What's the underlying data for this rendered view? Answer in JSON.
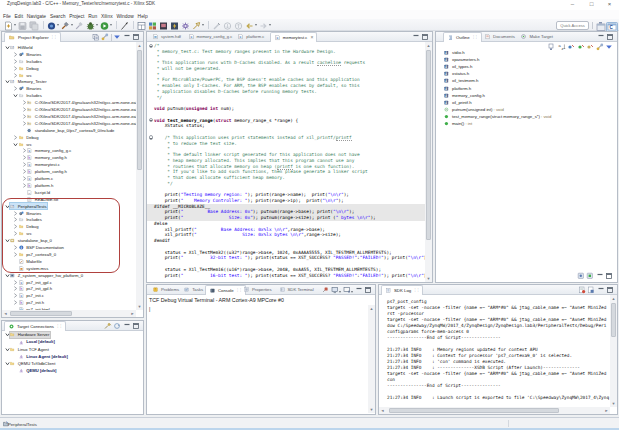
{
  "window": {
    "title": "ZynqDesign.lab3 - C/C++ - Memory_Tester/src/memorytest.c - Xilinx SDK",
    "controls": {
      "minimize": "–",
      "maximize": "□",
      "close": "×"
    }
  },
  "menu": {
    "items": [
      "File",
      "Edit",
      "Navigate",
      "Search",
      "Project",
      "Run",
      "Xilinx",
      "Window",
      "Help"
    ]
  },
  "toolbar": {
    "quick_access_label": "Quick Access",
    "icons": [
      "new-wizard",
      "save",
      "save-all",
      "sep",
      "debug-config",
      "build",
      "build-all",
      "debug",
      "run",
      "sep",
      "new-cpp",
      "sep",
      "window-grid",
      "program-fpga",
      "dump-data",
      "program-flash",
      "sdk-gear",
      "launch-shell",
      "sep",
      "mark-occurrences",
      "next-annotation",
      "prev-annotation",
      "back",
      "forward"
    ],
    "perspective_icons": [
      "open-perspective",
      "cpp-perspective"
    ]
  },
  "project_explorer": {
    "tab": "Project Explorer",
    "header_icons": [
      "collapse-all",
      "link-editor",
      "hsep",
      "view-menu",
      "minimize",
      "maximize"
    ],
    "tree": [
      {
        "lv": 0,
        "ar": "v",
        "ic": "cproj",
        "lb": "HiWorld"
      },
      {
        "lv": 1,
        "ar": ">",
        "ic": "bin",
        "lb": "Binaries"
      },
      {
        "lv": 1,
        "ar": ">",
        "ic": "incs",
        "lb": "Includes"
      },
      {
        "lv": 1,
        "ar": ">",
        "ic": "fold",
        "lb": "Debug"
      },
      {
        "lv": 1,
        "ar": ">",
        "ic": "fold",
        "lb": "src"
      },
      {
        "lv": 0,
        "ar": "v",
        "ic": "cproj",
        "lb": "Memory_Tester"
      },
      {
        "lv": 1,
        "ar": ">",
        "ic": "bin",
        "lb": "Binaries"
      },
      {
        "lv": 1,
        "ar": "v",
        "ic": "incs",
        "lb": "Includes"
      },
      {
        "lv": 2,
        "ar": ">",
        "ic": "incpath",
        "lb": "C:/Xilinx/SDK/2017.4/gnu/aarch32/nt/gcc-arm-none-eabi/arm-none-eabi/include"
      },
      {
        "lv": 2,
        "ar": ">",
        "ic": "incpath",
        "lb": "C:/Xilinx/SDK/2017.4/gnu/aarch32/nt/gcc-arm-none-eabi/arm-none-eabi/include"
      },
      {
        "lv": 2,
        "ar": ">",
        "ic": "incpath",
        "lb": "C:/Xilinx/SDK/2017.4/gnu/aarch32/nt/gcc-arm-none-eabi/arm-none-eabi/include"
      },
      {
        "lv": 2,
        "ar": ">",
        "ic": "incpath",
        "lb": "C:/Xilinx/SDK/2017.4/gnu/aarch32/nt/gcc-arm-none-eabi/arm-none-eabi/include"
      },
      {
        "lv": 2,
        "ar": "",
        "ic": "gearinc",
        "lb": "standalone_bsp_0/ps7_cortexa9_0/include"
      },
      {
        "lv": 1,
        "ar": ">",
        "ic": "fold",
        "lb": "Debug"
      },
      {
        "lv": 1,
        "ar": "v",
        "ic": "fold",
        "lb": "src"
      },
      {
        "lv": 2,
        "ar": ">",
        "ic": "cfile",
        "lb": "memory_config_g.c"
      },
      {
        "lv": 2,
        "ar": ">",
        "ic": "hfile",
        "lb": "memory_config.h"
      },
      {
        "lv": 2,
        "ar": ">",
        "ic": "cfile",
        "lb": "memorytest.c"
      },
      {
        "lv": 2,
        "ar": ">",
        "ic": "hfile",
        "lb": "platform_config.h"
      },
      {
        "lv": 2,
        "ar": ">",
        "ic": "cfile",
        "lb": "platform.c"
      },
      {
        "lv": 2,
        "ar": ">",
        "ic": "hfile",
        "lb": "platform.h"
      },
      {
        "lv": 2,
        "ar": "",
        "ic": "ldfile",
        "lb": "lscript.ld"
      },
      {
        "lv": 2,
        "ar": "",
        "ic": "txtfile",
        "lb": "README.txt"
      },
      {
        "lv": 0,
        "ar": "v",
        "ic": "cproj",
        "lb": "PeripheralTests",
        "sel": 1
      },
      {
        "lv": 1,
        "ar": ">",
        "ic": "bin",
        "lb": "Binaries"
      },
      {
        "lv": 1,
        "ar": ">",
        "ic": "incs",
        "lb": "Includes"
      },
      {
        "lv": 1,
        "ar": ">",
        "ic": "fold",
        "lb": "Debug"
      },
      {
        "lv": 1,
        "ar": ">",
        "ic": "fold",
        "lb": "src"
      },
      {
        "lv": 0,
        "ar": "v",
        "ic": "bsp",
        "lb": "standalone_bsp_0"
      },
      {
        "lv": 1,
        "ar": ">",
        "ic": "info",
        "lb": "BSP Documentation"
      },
      {
        "lv": 1,
        "ar": ">",
        "ic": "fold",
        "lb": "ps7_cortexa9_0"
      },
      {
        "lv": 1,
        "ar": "",
        "ic": "makefile",
        "lb": "Makefile"
      },
      {
        "lv": 1,
        "ar": "",
        "ic": "mss",
        "lb": "system.mss"
      },
      {
        "lv": 0,
        "ar": "v",
        "ic": "hw",
        "lb": "Z_system_wrapper_hw_platform_0"
      },
      {
        "lv": 1,
        "ar": ">",
        "ic": "cfile",
        "lb": "ps7_init_gpl.c"
      },
      {
        "lv": 1,
        "ar": ">",
        "ic": "hfile",
        "lb": "ps7_init_gpl.h"
      },
      {
        "lv": 1,
        "ar": ">",
        "ic": "cfile",
        "lb": "ps7_init.c"
      },
      {
        "lv": 1,
        "ar": ">",
        "ic": "hfile",
        "lb": "ps7_init.h"
      },
      {
        "lv": 1,
        "ar": "",
        "ic": "html",
        "lb": "ps7_init.html"
      }
    ]
  },
  "target_connections": {
    "tab": "Target Connections",
    "header_icons": [
      "new-connection",
      "refresh-connection",
      "minimize",
      "maximize"
    ],
    "tree": [
      {
        "lv": 0,
        "ar": "v",
        "ic": "fold",
        "lb": "Hardware Server",
        "sel": 1
      },
      {
        "lv": 1,
        "ar": "",
        "ic": "target",
        "lb": "Local [default]",
        "bold": 1
      },
      {
        "lv": 0,
        "ar": "v",
        "ic": "fold",
        "lb": "Linux TCF Agent"
      },
      {
        "lv": 1,
        "ar": "",
        "ic": "target",
        "lb": "Linux Agent [default]",
        "bold": 1
      },
      {
        "lv": 0,
        "ar": "v",
        "ic": "fold",
        "lb": "QEMU TcfGdbClient"
      },
      {
        "lv": 1,
        "ar": "",
        "ic": "target",
        "lb": "QEMU [default]",
        "bold": 1
      }
    ]
  },
  "editor": {
    "tabs": [
      {
        "label": "system.hdf",
        "icon": "hdf"
      },
      {
        "label": "memory_config_g.c",
        "icon": "cfile"
      },
      {
        "label": "platform.c",
        "icon": "cfile"
      },
      {
        "label": "memorytest.c",
        "icon": "cfile",
        "active": 1,
        "close": "×"
      }
    ],
    "header_icons": [
      "minimize",
      "maximize"
    ],
    "code": [
      {
        "sp": [
          [
            "c",
            "/*"
          ]
        ]
      },
      {
        "sp": [
          [
            "c",
            " * memory_test.c: Test memory ranges present in the Hardware Design."
          ]
        ]
      },
      {
        "sp": [
          [
            "c",
            " *"
          ]
        ]
      },
      {
        "sp": [
          [
            "c",
            " * This application runs with D-Caches disabled. As a result "
          ],
          [
            "u",
            "cacheline"
          ],
          [
            "c",
            " requests"
          ]
        ]
      },
      {
        "sp": [
          [
            "c",
            " * will not be generated."
          ]
        ]
      },
      {
        "sp": [
          [
            "c",
            " *"
          ]
        ]
      },
      {
        "sp": [
          [
            "c",
            " * For MicroBlaze/PowerPC, the BSP doesn't enable caches and this application"
          ]
        ]
      },
      {
        "sp": [
          [
            "c",
            " * enables only I-Caches. For ARM, the BSP enables caches by default, so this"
          ]
        ]
      },
      {
        "sp": [
          [
            "c",
            " * application disables D-Caches before running memory tests."
          ]
        ]
      },
      {
        "sp": [
          [
            "c",
            " */"
          ]
        ]
      },
      {
        "sp": []
      },
      {
        "sp": [
          [
            "k",
            "void"
          ],
          [
            "p",
            " putnum("
          ],
          [
            "k",
            "unsigned"
          ],
          [
            "p",
            " "
          ],
          [
            "k",
            "int"
          ],
          [
            "p",
            " num);"
          ]
        ]
      },
      {
        "sp": []
      },
      {
        "sp": [
          [
            "k",
            "void"
          ],
          [
            "p",
            " "
          ],
          [
            "f",
            "test_memory_range"
          ],
          [
            "p",
            "("
          ],
          [
            "k",
            "struct"
          ],
          [
            "p",
            " memory_range_s *range) {"
          ]
        ]
      },
      {
        "sp": [
          [
            "p",
            "    XStatus status;"
          ]
        ]
      },
      {
        "sp": []
      },
      {
        "sp": [
          [
            "c",
            "    /* This application uses print statements instead of xil_printf/"
          ],
          [
            "u",
            "printf"
          ]
        ]
      },
      {
        "sp": [
          [
            "c",
            "     * to reduce the text size."
          ]
        ]
      },
      {
        "sp": [
          [
            "c",
            "     *"
          ]
        ]
      },
      {
        "sp": [
          [
            "c",
            "     * The default linker script generated for this application does not have"
          ]
        ]
      },
      {
        "sp": [
          [
            "c",
            "     * heap memory allocated. This implies that this program cannot use any"
          ]
        ]
      },
      {
        "sp": [
          [
            "c",
            "     * routines that allocate memory on heap ("
          ],
          [
            "u",
            "printf"
          ],
          [
            "c",
            " is one such function)."
          ]
        ]
      },
      {
        "sp": [
          [
            "c",
            "     * If you'd like to add such functions, then please generate a linker script"
          ]
        ]
      },
      {
        "sp": [
          [
            "c",
            "     * that does allocate sufficient heap memory."
          ]
        ]
      },
      {
        "sp": [
          [
            "c",
            "     */"
          ]
        ]
      },
      {
        "sp": []
      },
      {
        "sp": [
          [
            "p",
            "    print("
          ],
          [
            "s",
            "\"Testing memory region: \""
          ],
          [
            "p",
            "); print(range->name);  print("
          ],
          [
            "s",
            "\"\\n\\r\""
          ],
          [
            "p",
            ");"
          ]
        ]
      },
      {
        "sp": [
          [
            "p",
            "    print("
          ],
          [
            "s",
            "\"    Memory Controller: \""
          ],
          [
            "p",
            "); print(range->ip);  print("
          ],
          [
            "s",
            "\"\\n\\r\""
          ],
          [
            "p",
            ");"
          ]
        ]
      },
      {
        "bg": 1,
        "sp": [
          [
            "d",
            "#ifdef __MICROBLAZE__"
          ]
        ]
      },
      {
        "bg": 1,
        "sp": [
          [
            "p",
            "    print("
          ],
          [
            "s",
            "\"         Base Address: 0x\""
          ],
          [
            "p",
            "); putnum(range->base); print("
          ],
          [
            "s",
            "\"\\n\\r\""
          ],
          [
            "p",
            ");"
          ]
        ]
      },
      {
        "bg": 1,
        "sp": [
          [
            "p",
            "    print("
          ],
          [
            "s",
            "\"                 Size: 0x\""
          ],
          [
            "p",
            "); putnum(range->size); print ("
          ],
          [
            "s",
            "\" bytes \\n\\r\""
          ],
          [
            "p",
            ");"
          ]
        ]
      },
      {
        "sp": [
          [
            "d",
            "#else"
          ]
        ]
      },
      {
        "sp": [
          [
            "p",
            "    xil_printf("
          ],
          [
            "s",
            "\"         Base Address: 0x%lx \\n\\r\""
          ],
          [
            "p",
            ",range->base);"
          ]
        ]
      },
      {
        "sp": [
          [
            "p",
            "    xil_printf("
          ],
          [
            "s",
            "\"                 Size: 0x%lx bytes \\n\\r\""
          ],
          [
            "p",
            ",range->size);"
          ]
        ]
      },
      {
        "sp": [
          [
            "d",
            "#endif"
          ]
        ]
      },
      {
        "sp": []
      },
      {
        "sp": [
          [
            "p",
            "    status = Xil_TestMem32((u32*)range->base, 1024, 0xAAAA5555, XIL_TESTMEM_ALLMEMTESTS);"
          ]
        ]
      },
      {
        "sp": [
          [
            "p",
            "    print("
          ],
          [
            "s",
            "\"          32-bit test: \""
          ],
          [
            "p",
            "); print(status == XST_SUCCESS? "
          ],
          [
            "s",
            "\"PASSED!\""
          ],
          [
            "p",
            ":"
          ],
          [
            "s",
            "\"FAILED!\""
          ],
          [
            "p",
            "); print("
          ],
          [
            "s",
            "\"\\n\\r\""
          ],
          [
            "p",
            ");"
          ]
        ]
      },
      {
        "sp": []
      },
      {
        "sp": [
          [
            "p",
            "    status = Xil_TestMem16((u16*)range->base, 2048, 0xAA55, XIL_TESTMEM_ALLMEMTESTS);"
          ]
        ]
      },
      {
        "sp": [
          [
            "p",
            "    print("
          ],
          [
            "s",
            "\"          16-bit test: \""
          ],
          [
            "p",
            "); print(status == XST_SUCCESS? "
          ],
          [
            "s",
            "\"PASSED!\""
          ],
          [
            "p",
            ":"
          ],
          [
            "s",
            "\"FAILED!\""
          ],
          [
            "p",
            "); print("
          ],
          [
            "s",
            "\"\\n\\r\""
          ],
          [
            "p",
            ");"
          ]
        ]
      }
    ],
    "fold_lines": [
      1,
      14,
      17
    ],
    "colors": {
      "comment": "#3f7f5f",
      "keyword": "#7f0055",
      "string": "#2a00ff",
      "directive": "#555555",
      "plain": "#000000",
      "inactive_bg": "#e7e7e7"
    }
  },
  "outline": {
    "tabs": [
      {
        "label": "Outline",
        "icon": "outline",
        "active": 1
      },
      {
        "label": "Documents",
        "icon": "docs"
      },
      {
        "label": "Make Target",
        "icon": "maketarget"
      }
    ],
    "header_icons": [
      "minimize",
      "maximize"
    ],
    "toolbar_icons": [
      "expand-all",
      "sort-az",
      "hide-fields",
      "hide-static",
      "hide-non-public",
      "link-editor",
      "view-menu"
    ],
    "items": [
      {
        "ic": "incl",
        "lb": "stdio.h"
      },
      {
        "ic": "incl",
        "lb": "xparameters.h"
      },
      {
        "ic": "incl",
        "lb": "xil_types.h"
      },
      {
        "ic": "incl",
        "lb": "xstatus.h"
      },
      {
        "ic": "incl",
        "lb": "xil_testmem.h"
      },
      {
        "ic": "incl",
        "lb": "platform.h"
      },
      {
        "ic": "incl",
        "lb": "memory_config.h"
      },
      {
        "ic": "incl",
        "lb": "xil_printf.h"
      },
      {
        "ic": "fndecl",
        "lb": "putnum(unsigned int)",
        "sf": " : void"
      },
      {
        "ic": "fn",
        "lb": "test_memory_range(struct memory_range_s*)",
        "sf": " : void"
      },
      {
        "ic": "fn",
        "lb": "main()",
        "sf": " : int"
      }
    ],
    "bottom_icons": [
      "pin-a",
      "pin-b",
      "minimize",
      "maximize"
    ]
  },
  "console": {
    "tabs": [
      {
        "label": "Problems",
        "icon": "problems"
      },
      {
        "label": "Tasks",
        "icon": "tasks"
      },
      {
        "label": "Console",
        "icon": "console",
        "active": 1
      },
      {
        "label": "Properties",
        "icon": "properties"
      },
      {
        "label": "SDK Terminal",
        "icon": "terminal"
      }
    ],
    "title": "TCF Debug Virtual Terminal - ARM Cortex-A9 MPCore #0",
    "header_icons": [
      "pin-console",
      "display-console",
      "caret",
      "open-console",
      "caret",
      "minimize",
      "maximize"
    ],
    "cursor": "|"
  },
  "sdk_log": {
    "tab": "SDK Log",
    "header_icons": [
      "clear-log",
      "save-log",
      "minimize",
      "maximize"
    ],
    "lines": [
      "ps7_post_config",
      "targets -set -nocase -filter {name =~ \"ARM*#0\" && jtag_cable_name =~ \"Avnet MiniZed",
      "rst -processor",
      "targets -set -nocase -filter {name =~ \"ARM*#0\" && jtag_cable_name =~ \"Avnet MiniZed",
      "dow C:/Speedway/ZynqMW/2017_4/ZynqDesign/ZynqDesign.lab3/PeripheralTests/Debug/Peri",
      "configparams force-mem-access 0",
      "---------------End of Script---------------",
      "",
      "21:27:34 INFO    : Memory regions updated for context APU",
      "21:27:34 INFO    : Context for processor 'ps7_cortexa9_0' is selected.",
      "21:27:34 INFO    : 'con' command is executed.",
      "21:27:34 INFO    : --------------XSDB Script (After Launch)--------------",
      "targets -set -nocase -filter {name =~ \"ARM*#0\" && jtag_cable_name =~ \"Avnet MiniZed",
      "con",
      "---------------End of Script---------------",
      "",
      "21:27:34 INFO    : Launch script is exported to file 'C:\\Speedway\\ZynqMW\\2017_4\\Zynq"
    ]
  },
  "status_bar": {
    "text": "PeripheralTests"
  },
  "annotation": {
    "color": "#b0413e"
  }
}
